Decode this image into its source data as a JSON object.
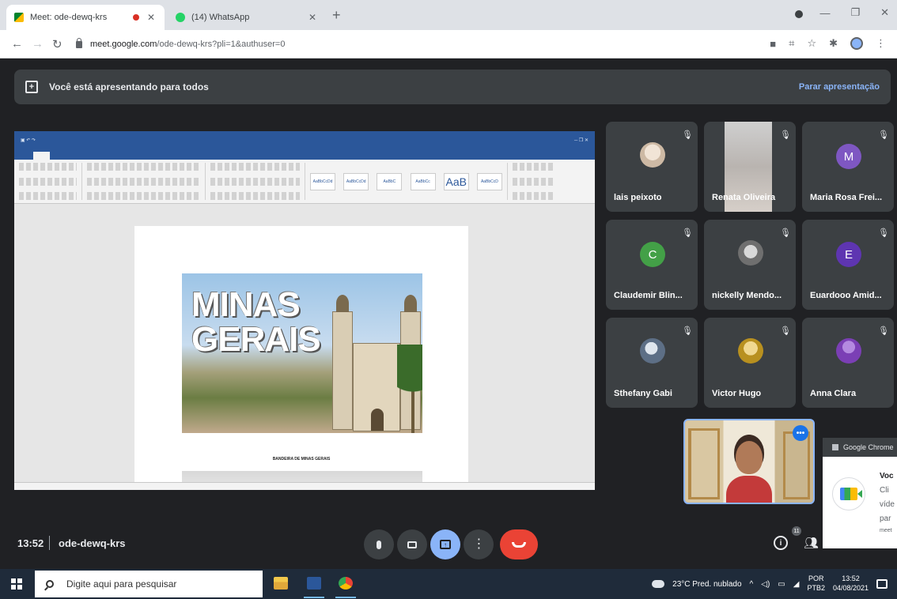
{
  "browser": {
    "tabs": [
      {
        "title": "Meet: ode-dewq-krs",
        "active": true
      },
      {
        "title": "(14) WhatsApp",
        "active": false
      }
    ],
    "url_host": "meet.google.com",
    "url_path": "/ode-dewq-krs?pli=1&authuser=0"
  },
  "meet": {
    "banner_text": "Você está apresentando para todos",
    "stop_presenting": "Parar apresentação",
    "participants": [
      {
        "name": "lais peixoto",
        "avatar": "photo",
        "color": "#e7d4c2"
      },
      {
        "name": "Renata Oliveira",
        "avatar": "video",
        "color": "#cfcfcf"
      },
      {
        "name": "Maria Rosa Frei...",
        "avatar": "letter",
        "letter": "M",
        "color": "#7e57c2"
      },
      {
        "name": "Claudemir Blin...",
        "avatar": "letter",
        "letter": "C",
        "color": "#43a047"
      },
      {
        "name": "nickelly Mendo...",
        "avatar": "photo",
        "color": "#9e9e9e"
      },
      {
        "name": "Euardooo Amid...",
        "avatar": "letter",
        "letter": "E",
        "color": "#5e35b1"
      },
      {
        "name": "Sthefany Gabi",
        "avatar": "photo",
        "color": "#6b7c93"
      },
      {
        "name": "Victor Hugo",
        "avatar": "photo",
        "color": "#c9a227"
      },
      {
        "name": "Anna Clara",
        "avatar": "photo",
        "color": "#7b3fb5"
      }
    ],
    "time": "13:52",
    "meeting_code": "ode-dewq-krs",
    "people_count": "11"
  },
  "shared_doc": {
    "cover_line1": "MINAS",
    "cover_line2": "GERAIS",
    "caption": "BANDEIRA DE MINAS GERAIS"
  },
  "notification": {
    "app": "Google Chrome",
    "title": "Voc",
    "lines": [
      "Cli",
      "víde",
      "par",
      "meet"
    ]
  },
  "taskbar": {
    "search_placeholder": "Digite aqui para pesquisar",
    "weather": "23°C Pred. nublado",
    "lang_top": "POR",
    "lang_bottom": "PTB2",
    "clock_time": "13:52",
    "clock_date": "04/08/2021"
  },
  "colors": {
    "meet_bg": "#202124",
    "tile_bg": "#3c4043",
    "accent_blue": "#8ab4f8",
    "leave_red": "#ea4335",
    "word_blue": "#2b579a"
  }
}
